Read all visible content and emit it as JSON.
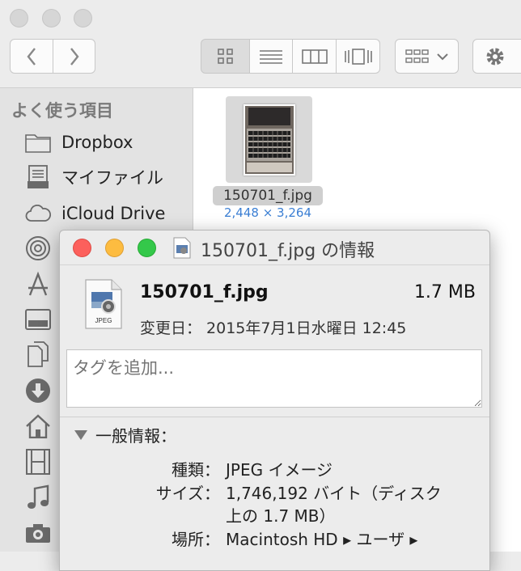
{
  "toolbar": {
    "back_icon": "chevron-left-icon",
    "forward_icon": "chevron-right-icon",
    "view_modes": [
      "icon-view-icon",
      "list-view-icon",
      "column-view-icon",
      "coverflow-view-icon"
    ],
    "arrange_icon": "arrange-grid-icon",
    "action_icon": "gear-icon"
  },
  "sidebar": {
    "heading": "よく使う項目",
    "items": [
      {
        "label": "Dropbox",
        "icon": "folder-icon"
      },
      {
        "label": "マイファイル",
        "icon": "all-my-files-icon"
      },
      {
        "label": "iCloud Drive",
        "icon": "cloud-icon"
      },
      {
        "label": "",
        "icon": "airdrop-icon"
      },
      {
        "label": "",
        "icon": "applications-icon"
      },
      {
        "label": "",
        "icon": "desktop-icon"
      },
      {
        "label": "",
        "icon": "documents-icon"
      },
      {
        "label": "",
        "icon": "downloads-icon"
      },
      {
        "label": "",
        "icon": "home-icon"
      },
      {
        "label": "",
        "icon": "movies-icon"
      },
      {
        "label": "",
        "icon": "music-icon"
      },
      {
        "label": "",
        "icon": "pictures-icon"
      }
    ]
  },
  "file": {
    "name": "150701_f.jpg",
    "dimensions": "2,448 × 3,264"
  },
  "info_window": {
    "title": "150701_f.jpg の情報",
    "file_name": "150701_f.jpg",
    "file_size": "1.7 MB",
    "modified": "変更日： 2015年7月1日水曜日 12:45",
    "tag_placeholder": "タグを追加...",
    "section_general": "一般情報：",
    "kind_label": "種類：",
    "kind_value": "JPEG イメージ",
    "size_label": "サイズ：",
    "size_value_line1": "1,746,192 バイト（ディスク",
    "size_value_line2": "上の 1.7 MB）",
    "where_label": "場所：",
    "where_value": "Macintosh HD ▸ ユーザ ▸",
    "doc_icon_text": "JPEG",
    "close_color": "#fc605c",
    "minimize_color": "#fdbc40",
    "zoom_color": "#34c84a"
  }
}
